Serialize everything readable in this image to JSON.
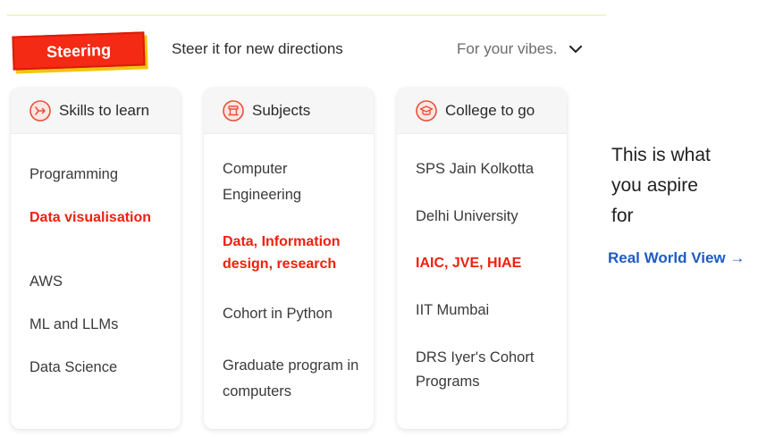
{
  "header": {
    "badge": "Steering",
    "tagline": "Steer it for new directions",
    "dropdown_label": "For your vibes."
  },
  "colors": {
    "badge_bg": "#f42a14",
    "badge_shadow": "#f2c511",
    "highlight": "#f0200d",
    "link": "#1e5bc6",
    "icon_accent": "#e8503a"
  },
  "cards": [
    {
      "title": "Skills to learn",
      "icon": "arrow-circle-icon",
      "items": [
        "Programming",
        "Data visualisation",
        "AWS",
        "ML and LLMs",
        "Data Science"
      ]
    },
    {
      "title": "Subjects",
      "icon": "podium-icon",
      "items": [
        "Computer Engineering",
        "Data, Information design, research",
        "Cohort in Python",
        "Graduate program in computers"
      ]
    },
    {
      "title": "College to go",
      "icon": "graduation-cap-icon",
      "items": [
        "SPS Jain Kolkotta",
        "Delhi University",
        "IAIC, JVE, HIAE",
        "IIT Mumbai",
        "DRS Iyer's Cohort Programs"
      ]
    }
  ],
  "aside": {
    "line1": "This is what",
    "line2": "you aspire",
    "line3": "for",
    "link": "Real World View →"
  }
}
